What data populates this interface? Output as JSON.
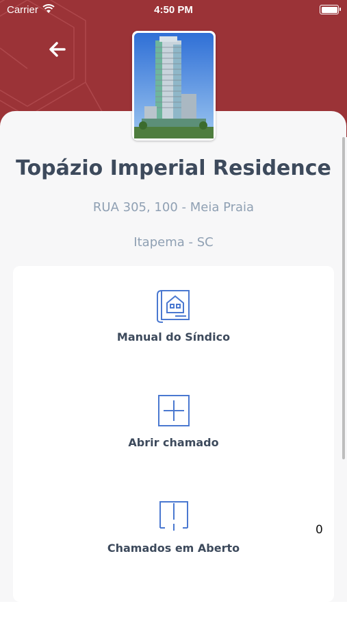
{
  "status_bar": {
    "carrier": "Carrier",
    "time": "4:50 PM"
  },
  "header": {
    "back_icon": "arrow-left-icon",
    "color": "#9b3337"
  },
  "building": {
    "name": "Topázio Imperial Residence",
    "address": "RUA 305, 100 - Meia Praia",
    "city": "Itapema - SC"
  },
  "menu": {
    "items": [
      {
        "label": "Manual do Síndico",
        "icon": "blueprint-house-icon"
      },
      {
        "label": "Abrir chamado",
        "icon": "plus-square-icon"
      },
      {
        "label": "Chamados em Aberto",
        "icon": "door-icon",
        "count": "0"
      }
    ]
  },
  "colors": {
    "text_dark": "#3d4a5c",
    "text_muted": "#8fa0b3",
    "icon_blue": "#4a78d0"
  }
}
